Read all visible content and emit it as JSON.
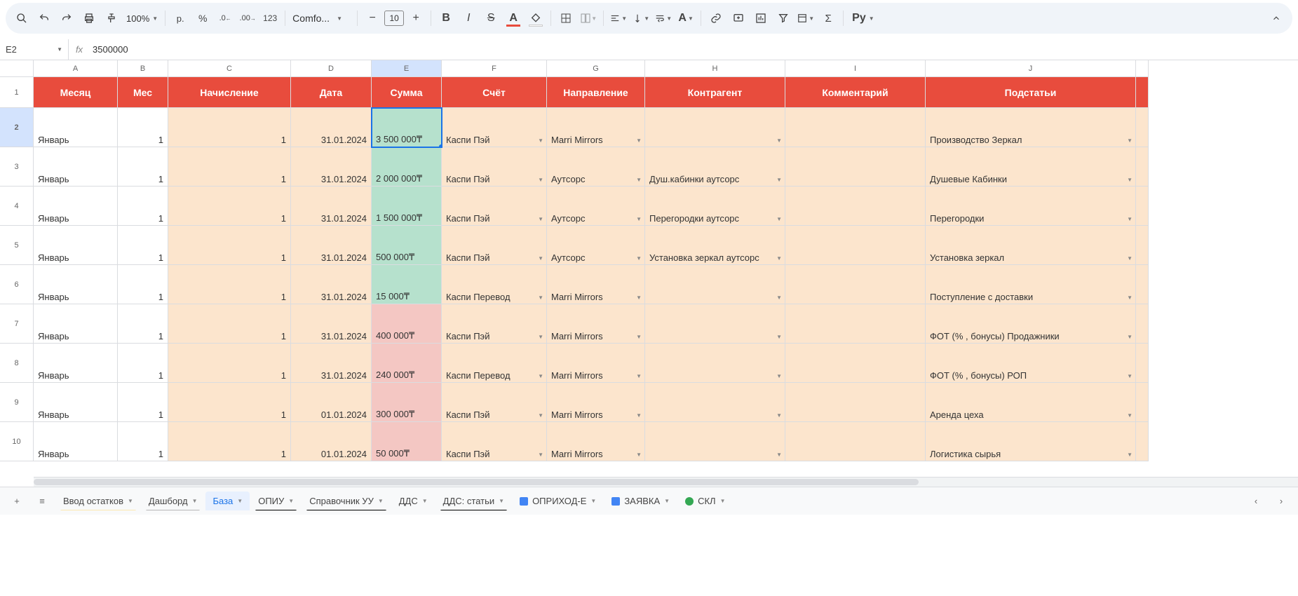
{
  "toolbar": {
    "zoom": "100%",
    "currency": "р.",
    "percent": "%",
    "dec_dec": ".0",
    "dec_inc": ".00",
    "num_fmt": "123",
    "font": "Comfo...",
    "font_size": "10",
    "bold": "B",
    "italic": "I",
    "strike": "S",
    "py": "Py"
  },
  "name_box": "E2",
  "fx": "fx",
  "formula": "3500000",
  "col_letters": [
    "A",
    "B",
    "C",
    "D",
    "E",
    "F",
    "G",
    "H",
    "I",
    "J"
  ],
  "headers": [
    "Месяц",
    "Мес",
    "Начисление",
    "Дата",
    "Сумма",
    "Счёт",
    "Направление",
    "Контрагент",
    "Комментарий",
    "Подстатьи"
  ],
  "rows": [
    {
      "n": "2",
      "month": "Январь",
      "mes": "1",
      "accr": "1",
      "date": "31.01.2024",
      "sum": "3 500 000₸",
      "sum_c": "green",
      "acct": "Каспи Пэй",
      "dir": "Marri Mirrors",
      "agent": "",
      "comm": "",
      "sub": "Производство Зеркал",
      "sel": true
    },
    {
      "n": "3",
      "month": "Январь",
      "mes": "1",
      "accr": "1",
      "date": "31.01.2024",
      "sum": "2 000 000₸",
      "sum_c": "green",
      "acct": "Каспи Пэй",
      "dir": "Аутсорс",
      "agent": "Душ.кабинки аутсорс",
      "comm": "",
      "sub": "Душевые Кабинки"
    },
    {
      "n": "4",
      "month": "Январь",
      "mes": "1",
      "accr": "1",
      "date": "31.01.2024",
      "sum": "1 500 000₸",
      "sum_c": "green",
      "acct": "Каспи Пэй",
      "dir": "Аутсорс",
      "agent": "Перегородки аутсорс",
      "comm": "",
      "sub": "Перегородки"
    },
    {
      "n": "5",
      "month": "Январь",
      "mes": "1",
      "accr": "1",
      "date": "31.01.2024",
      "sum": "500 000₸",
      "sum_c": "green",
      "acct": "Каспи Пэй",
      "dir": "Аутсорс",
      "agent": "Установка зеркал аутсорс",
      "comm": "",
      "sub": "Установка зеркал"
    },
    {
      "n": "6",
      "month": "Январь",
      "mes": "1",
      "accr": "1",
      "date": "31.01.2024",
      "sum": "15 000₸",
      "sum_c": "green",
      "acct": "Каспи Перевод",
      "dir": "Marri Mirrors",
      "agent": "",
      "comm": "",
      "sub": "Поступление с доставки"
    },
    {
      "n": "7",
      "month": "Январь",
      "mes": "1",
      "accr": "1",
      "date": "31.01.2024",
      "sum": "400 000₸",
      "sum_c": "pink",
      "acct": "Каспи Пэй",
      "dir": "Marri Mirrors",
      "agent": "",
      "comm": "",
      "sub": "ФОТ (% , бонусы) Продажники"
    },
    {
      "n": "8",
      "month": "Январь",
      "mes": "1",
      "accr": "1",
      "date": "31.01.2024",
      "sum": "240 000₸",
      "sum_c": "pink",
      "acct": "Каспи Перевод",
      "dir": "Marri Mirrors",
      "agent": "",
      "comm": "",
      "sub": "ФОТ (% , бонусы) РОП"
    },
    {
      "n": "9",
      "month": "Январь",
      "mes": "1",
      "accr": "1",
      "date": "01.01.2024",
      "sum": "300 000₸",
      "sum_c": "pink",
      "acct": "Каспи Пэй",
      "dir": "Marri Mirrors",
      "agent": "",
      "comm": "",
      "sub": "Аренда цеха"
    },
    {
      "n": "10",
      "month": "Январь",
      "mes": "1",
      "accr": "1",
      "date": "01.01.2024",
      "sum": "50 000₸",
      "sum_c": "pink",
      "acct": "Каспи Пэй",
      "dir": "Marri Mirrors",
      "agent": "",
      "comm": "",
      "sub": "Логистика сырья"
    }
  ],
  "tabs": [
    {
      "label": "Ввод остатков",
      "color": "#fce8b2"
    },
    {
      "label": "Дашборд",
      "color": "#b7b7b7"
    },
    {
      "label": "База",
      "active": true
    },
    {
      "label": "ОПИУ",
      "color": "#000000"
    },
    {
      "label": "Справочник УУ",
      "color": "#000000"
    },
    {
      "label": "ДДС"
    },
    {
      "label": "ДДС: статьи",
      "color": "#000000"
    },
    {
      "label": "ОПРИХОД-Е",
      "icon": "#4285f4"
    },
    {
      "label": "ЗАЯВКА",
      "icon": "#4285f4"
    },
    {
      "label": "СКЛ",
      "icon": "#34a853"
    }
  ]
}
